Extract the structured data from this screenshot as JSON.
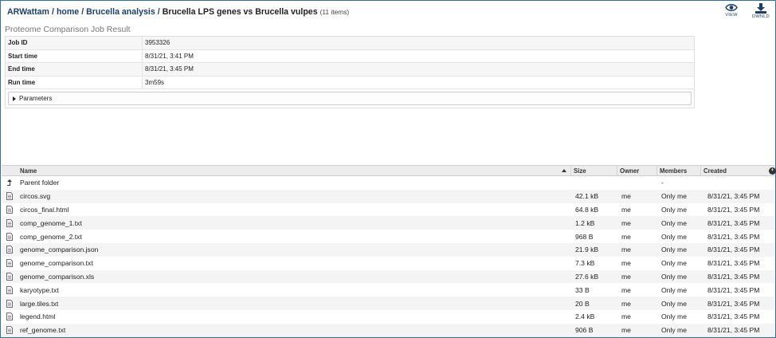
{
  "breadcrumb": {
    "user": "ARWattam",
    "home": "home",
    "folder": "Brucella analysis",
    "current": "Brucella LPS genes vs Brucella vulpes",
    "count": "(11 items)",
    "separator": "/"
  },
  "toolbar": {
    "view_label": "VIEW",
    "dwnld_label": "DWNLD"
  },
  "job": {
    "title": "Proteome Comparison Job Result",
    "rows": [
      {
        "key": "Job ID",
        "value": "3953326"
      },
      {
        "key": "Start time",
        "value": "8/31/21, 3:41 PM"
      },
      {
        "key": "End time",
        "value": "8/31/21, 3:45 PM"
      },
      {
        "key": "Run time",
        "value": "3m59s"
      }
    ],
    "parameters_label": "Parameters"
  },
  "grid": {
    "columns": {
      "name": "Name",
      "size": "Size",
      "owner": "Owner",
      "members": "Members",
      "created": "Created"
    },
    "parent_row": {
      "name": "Parent folder",
      "members": "-"
    },
    "rows": [
      {
        "name": "circos.svg",
        "size": "42.1 kB",
        "owner": "me",
        "members": "Only me",
        "created": "8/31/21, 3:45 PM"
      },
      {
        "name": "circos_final.html",
        "size": "64.8 kB",
        "owner": "me",
        "members": "Only me",
        "created": "8/31/21, 3:45 PM"
      },
      {
        "name": "comp_genome_1.txt",
        "size": "1.2 kB",
        "owner": "me",
        "members": "Only me",
        "created": "8/31/21, 3:45 PM"
      },
      {
        "name": "comp_genome_2.txt",
        "size": "968 B",
        "owner": "me",
        "members": "Only me",
        "created": "8/31/21, 3:45 PM"
      },
      {
        "name": "genome_comparison.json",
        "size": "21.9 kB",
        "owner": "me",
        "members": "Only me",
        "created": "8/31/21, 3:45 PM"
      },
      {
        "name": "genome_comparison.txt",
        "size": "7.3 kB",
        "owner": "me",
        "members": "Only me",
        "created": "8/31/21, 3:45 PM"
      },
      {
        "name": "genome_comparison.xls",
        "size": "27.6 kB",
        "owner": "me",
        "members": "Only me",
        "created": "8/31/21, 3:45 PM"
      },
      {
        "name": "karyotype.txt",
        "size": "33 B",
        "owner": "me",
        "members": "Only me",
        "created": "8/31/21, 3:45 PM"
      },
      {
        "name": "large.tiles.txt",
        "size": "20 B",
        "owner": "me",
        "members": "Only me",
        "created": "8/31/21, 3:45 PM"
      },
      {
        "name": "legend.html",
        "size": "2.4 kB",
        "owner": "me",
        "members": "Only me",
        "created": "8/31/21, 3:45 PM"
      },
      {
        "name": "ref_genome.txt",
        "size": "906 B",
        "owner": "me",
        "members": "Only me",
        "created": "8/31/21, 3:45 PM"
      }
    ]
  },
  "colors": {
    "frame": "#2f6fb5",
    "link": "#1c3f6e"
  }
}
